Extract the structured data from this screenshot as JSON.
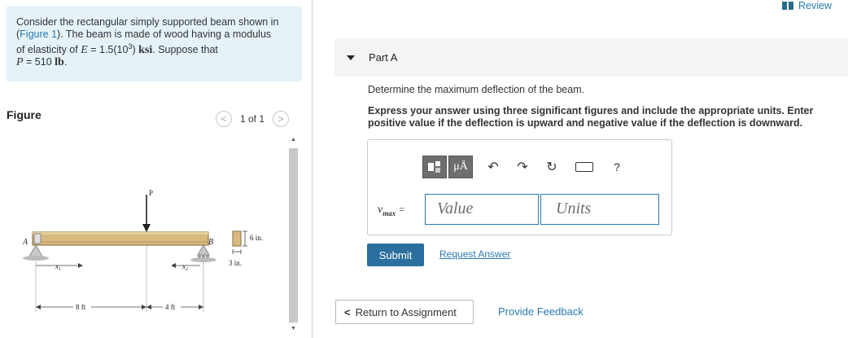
{
  "problem": {
    "t1": "Consider the rectangular simply supported beam shown in",
    "t2_open": "(",
    "figure_link": "Figure 1",
    "t2_close": "). The beam is made of wood having a modulus",
    "t3": "of elasticity of ",
    "E_symbol": "E",
    "t3_eq": " = 1.5(10",
    "t3_exp": "3",
    "t3_close": ") ",
    "E_unit": "ksi",
    "t3_end": ". Suppose that",
    "P_symbol": "P",
    "t4_eq": " = 510 ",
    "P_unit": "lb",
    "t4_end": "."
  },
  "figure": {
    "title": "Figure",
    "pager_prev": "<",
    "pager_count": "1 of 1",
    "pager_next": ">",
    "labels": {
      "load": "P",
      "end_a": "A",
      "end_b": "B",
      "x1": "x",
      "x1_sub": "1",
      "x2": "x",
      "x2_sub": "2",
      "span1": "8 ft",
      "span2": "4 ft",
      "height": "6 in.",
      "width": "3 in."
    }
  },
  "review": {
    "label": "Review"
  },
  "part": {
    "title": "Part A",
    "question": "Determine the maximum deflection of the beam.",
    "instructions": "Express your answer using three significant figures and include the appropriate units. Enter positive value if the deflection is upward and negative value if the deflection is downward."
  },
  "answer": {
    "var": "v",
    "var_sub": "max",
    "eq": "=",
    "value_placeholder": "Value",
    "units_placeholder": "Units",
    "toolbar": {
      "mu_label": "μÅ",
      "help": "?"
    }
  },
  "actions": {
    "submit": "Submit",
    "request": "Request Answer",
    "return_chev": "<",
    "return": "Return to Assignment",
    "feedback": "Provide Feedback"
  }
}
